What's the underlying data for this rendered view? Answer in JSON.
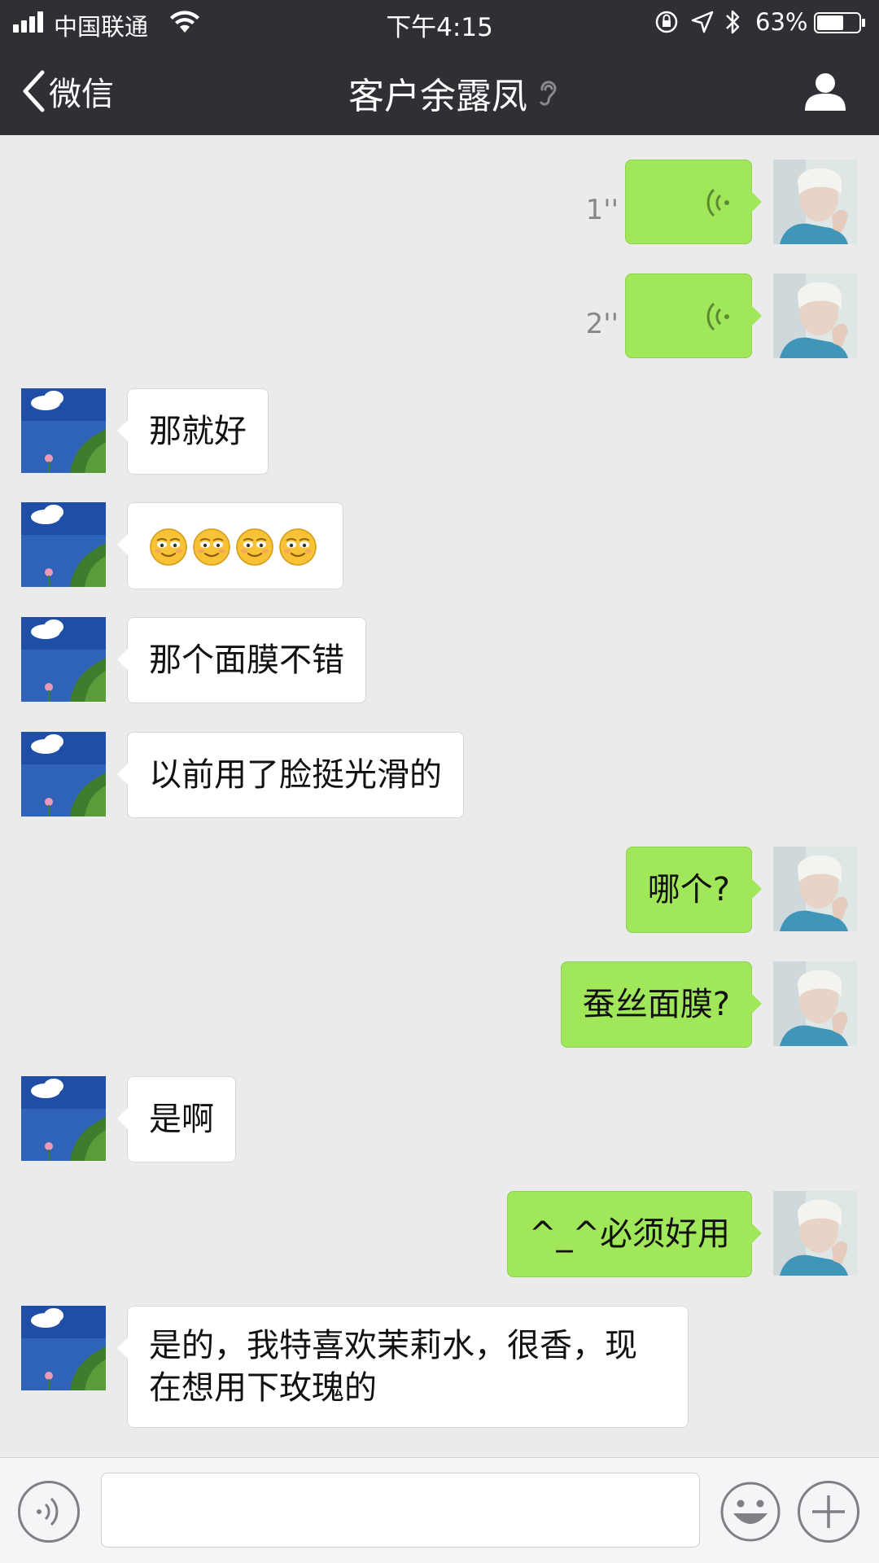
{
  "status_bar": {
    "carrier": "中国联通",
    "time": "下午4:15",
    "battery_percent": "63%",
    "battery_level": 0.63,
    "icons": [
      "signal-icon",
      "wifi-icon",
      "rotation-lock-icon",
      "location-icon",
      "bluetooth-icon",
      "battery-icon"
    ]
  },
  "navbar": {
    "back_label": "微信",
    "title": "客户余露凤",
    "right_icon": "profile-icon",
    "ear_icon": "earpiece-mode-icon"
  },
  "messages": [
    {
      "side": "right",
      "type": "voice",
      "duration": "1''"
    },
    {
      "side": "right",
      "type": "voice",
      "duration": "2''"
    },
    {
      "side": "left",
      "type": "text",
      "text": "那就好"
    },
    {
      "side": "left",
      "type": "emoji",
      "emoji_count": 4,
      "emoji_name": "smiling-face-emoji"
    },
    {
      "side": "left",
      "type": "text",
      "text": "那个面膜不错"
    },
    {
      "side": "left",
      "type": "text",
      "text": "以前用了脸挺光滑的"
    },
    {
      "side": "right",
      "type": "text",
      "text": "哪个?"
    },
    {
      "side": "right",
      "type": "text",
      "text": "蚕丝面膜?"
    },
    {
      "side": "left",
      "type": "text",
      "text": "是啊"
    },
    {
      "side": "right",
      "type": "text",
      "text": "^_^必须好用"
    },
    {
      "side": "left",
      "type": "text",
      "text": "是的，我特喜欢茉莉水，很香，现在想用下玫瑰的"
    }
  ],
  "input_bar": {
    "value": "",
    "icons": [
      "voice-input-icon",
      "emoji-icon",
      "plus-icon"
    ]
  },
  "colors": {
    "header_bg": "#2f3035",
    "chat_bg": "#ebebeb",
    "sent_bubble": "#a0e75a",
    "received_bubble": "#ffffff",
    "voice_wave": "#5b8a32"
  }
}
